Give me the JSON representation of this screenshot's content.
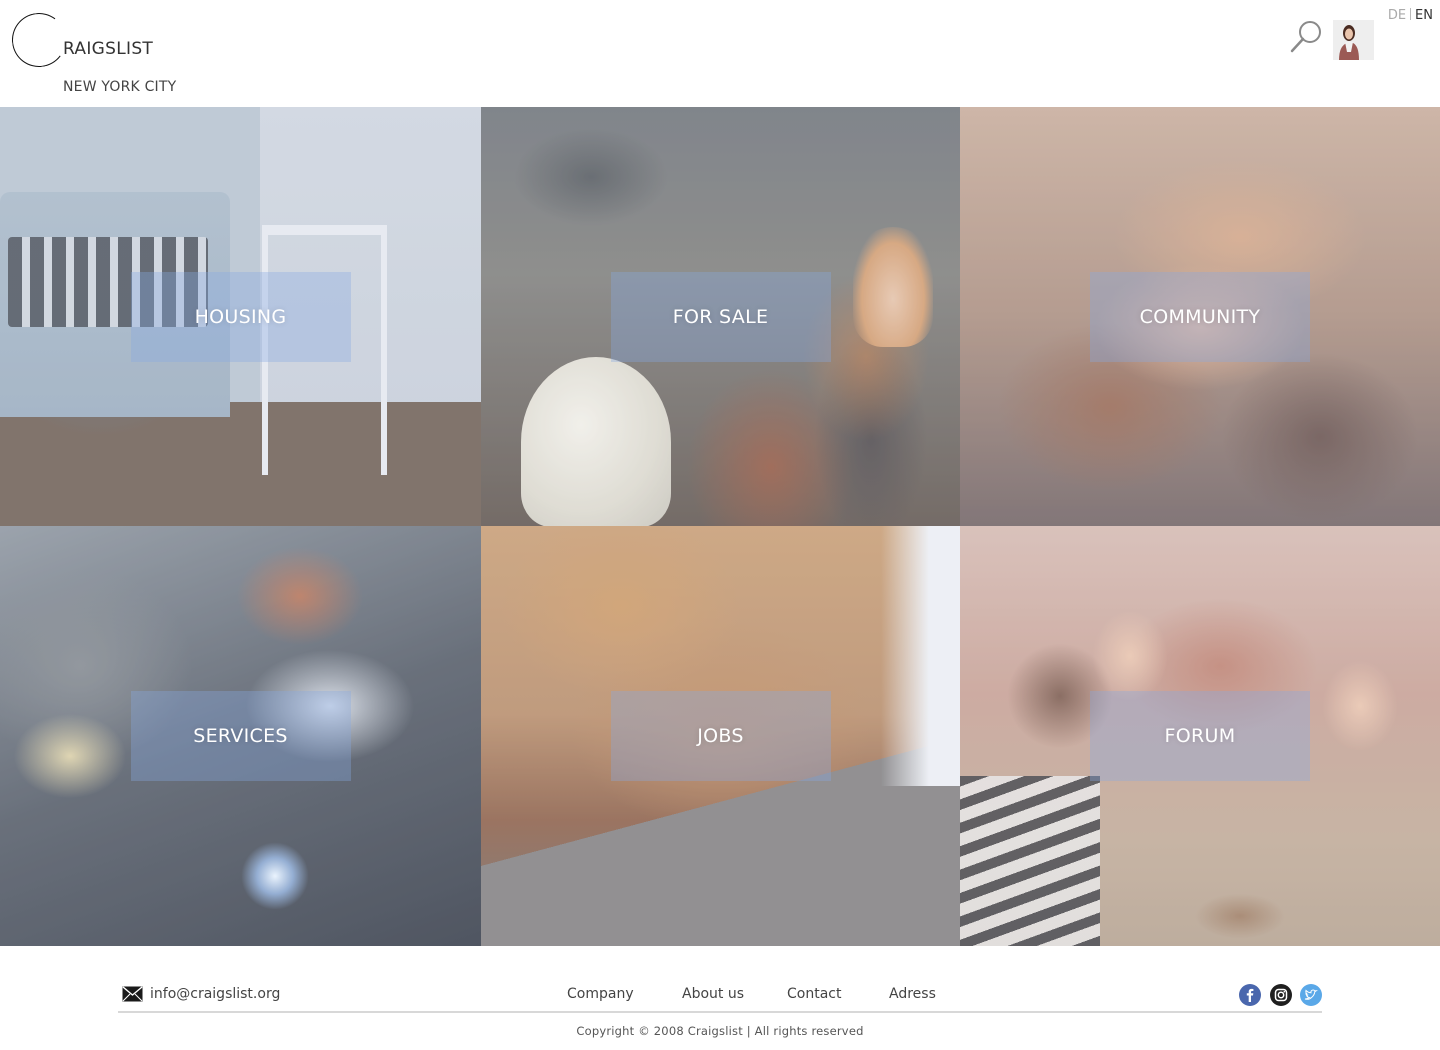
{
  "header": {
    "logo_letter": "C",
    "logo_rest": "RAIGSLIST",
    "city": "NEW YORK CITY",
    "lang_de": "DE",
    "lang_en": "EN",
    "search_icon": "magnifier-icon",
    "avatar_icon": "user-avatar"
  },
  "categories": [
    {
      "label": "HOUSING",
      "image": "living-room-sofa"
    },
    {
      "label": "FOR SALE",
      "image": "woman-in-shop"
    },
    {
      "label": "COMMUNITY",
      "image": "stacked-hands"
    },
    {
      "label": "SERVICES",
      "image": "welder-at-work"
    },
    {
      "label": "JOBS",
      "image": "typing-on-laptop"
    },
    {
      "label": "FORUM",
      "image": "friends-with-coffee"
    }
  ],
  "footer": {
    "email": "info@craigslist.org",
    "mail_icon": "envelope-icon",
    "links": [
      "Company",
      "About us",
      "Contact",
      "Adress"
    ],
    "social": [
      "facebook-icon",
      "instagram-icon",
      "twitter-icon"
    ],
    "copyright": "Copyright © 2008 Craigslist | All rights reserved"
  },
  "colors": {
    "label_box": "#87aae1",
    "facebook": "#4a67ad",
    "instagram": "#1f1f1f",
    "twitter": "#5aa8e8"
  }
}
